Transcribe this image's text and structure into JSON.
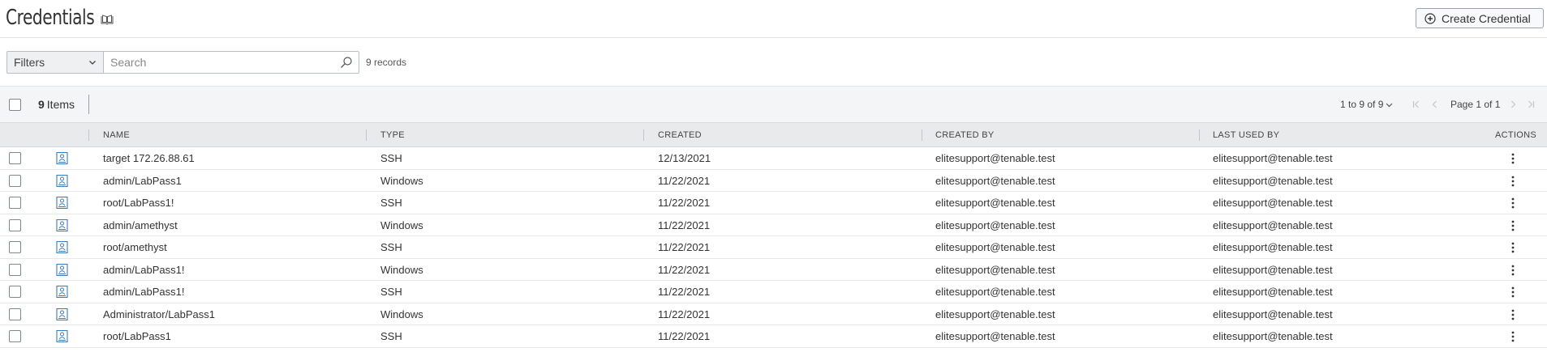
{
  "header": {
    "title": "Credentials",
    "help_icon": "book-icon",
    "create_button_label": "Create Credential",
    "create_button_icon": "plus-circle-icon"
  },
  "filterbar": {
    "filters_label": "Filters",
    "search_placeholder": "Search",
    "search_value": "",
    "records_text": "9 records"
  },
  "toolbar": {
    "items_count": "9",
    "items_label": "Items",
    "range_text": "1 to 9 of 9",
    "page_text": "Page 1 of 1"
  },
  "table": {
    "columns": [
      "NAME",
      "TYPE",
      "CREATED",
      "CREATED BY",
      "LAST USED BY",
      "ACTIONS"
    ],
    "rows": [
      {
        "name": "target 172.26.88.61",
        "type": "SSH",
        "created": "12/13/2021",
        "created_by": "elitesupport@tenable.test",
        "last_used_by": "elitesupport@tenable.test"
      },
      {
        "name": "admin/LabPass1",
        "type": "Windows",
        "created": "11/22/2021",
        "created_by": "elitesupport@tenable.test",
        "last_used_by": "elitesupport@tenable.test"
      },
      {
        "name": "root/LabPass1!",
        "type": "SSH",
        "created": "11/22/2021",
        "created_by": "elitesupport@tenable.test",
        "last_used_by": "elitesupport@tenable.test"
      },
      {
        "name": "admin/amethyst",
        "type": "Windows",
        "created": "11/22/2021",
        "created_by": "elitesupport@tenable.test",
        "last_used_by": "elitesupport@tenable.test"
      },
      {
        "name": "root/amethyst",
        "type": "SSH",
        "created": "11/22/2021",
        "created_by": "elitesupport@tenable.test",
        "last_used_by": "elitesupport@tenable.test"
      },
      {
        "name": "admin/LabPass1!",
        "type": "Windows",
        "created": "11/22/2021",
        "created_by": "elitesupport@tenable.test",
        "last_used_by": "elitesupport@tenable.test"
      },
      {
        "name": "admin/LabPass1!",
        "type": "SSH",
        "created": "11/22/2021",
        "created_by": "elitesupport@tenable.test",
        "last_used_by": "elitesupport@tenable.test"
      },
      {
        "name": "Administrator/LabPass1",
        "type": "Windows",
        "created": "11/22/2021",
        "created_by": "elitesupport@tenable.test",
        "last_used_by": "elitesupport@tenable.test"
      },
      {
        "name": "root/LabPass1",
        "type": "SSH",
        "created": "11/22/2021",
        "created_by": "elitesupport@tenable.test",
        "last_used_by": "elitesupport@tenable.test"
      }
    ]
  },
  "icons": {
    "row_type_icon": "credential-id-card-icon",
    "row_actions_icon": "kebab-menu-icon"
  },
  "colors": {
    "accent_blue": "#3d7ab8",
    "header_bg": "#e8eaec",
    "toolbar_bg": "#f4f5f6"
  }
}
